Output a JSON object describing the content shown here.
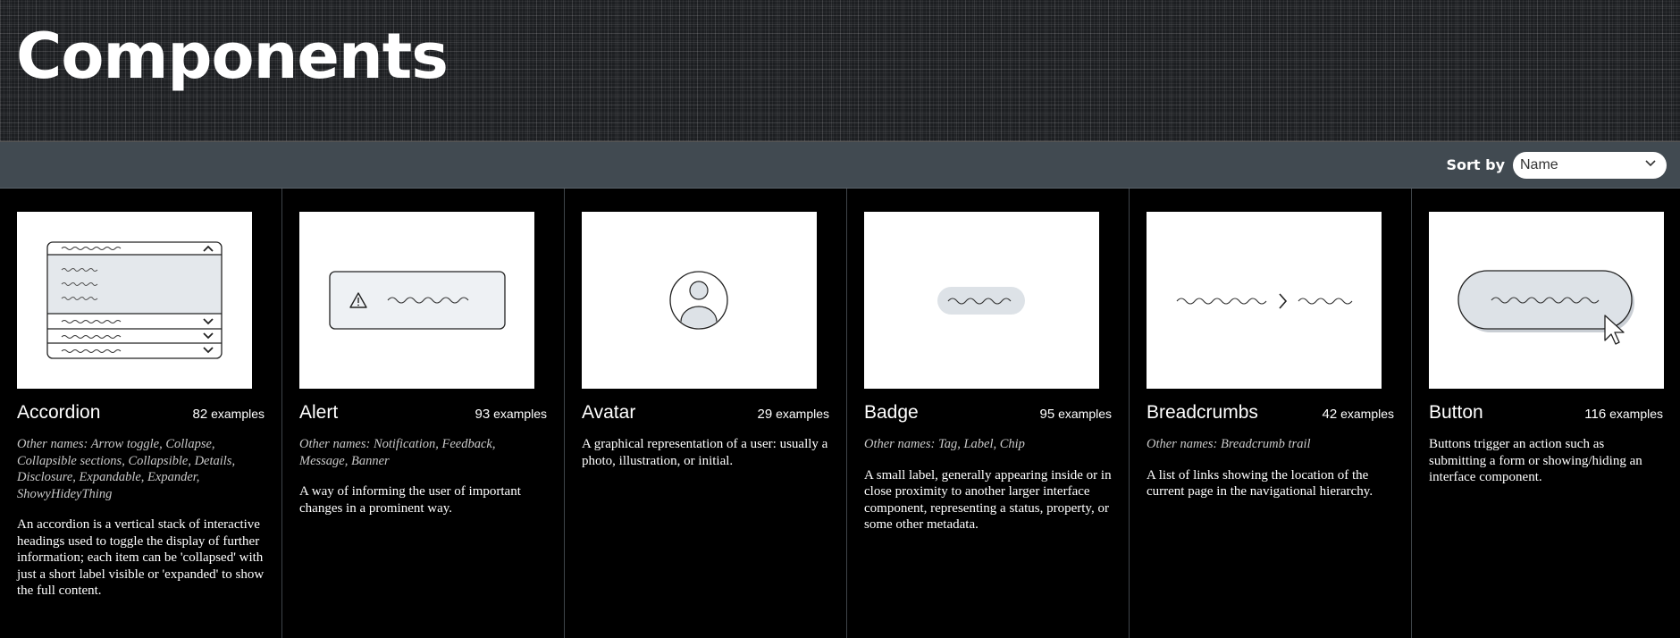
{
  "page": {
    "title": "Components"
  },
  "sort": {
    "label": "Sort by",
    "value": "Name"
  },
  "cards": [
    {
      "name": "Accordion",
      "count": "82",
      "count_suffix": "examples",
      "other_names": "Other names: Arrow toggle, Collapse, Collapsible sections, Collapsible, Details, Disclosure, Expandable, Expander, ShowyHideyThing",
      "description": "An accordion is a vertical stack of interactive headings used to toggle the display of further information; each item can be 'collapsed' with just a short label visible or 'expanded' to show the full content."
    },
    {
      "name": "Alert",
      "count": "93",
      "count_suffix": "examples",
      "other_names": "Other names: Notification, Feedback, Message, Banner",
      "description": "A way of informing the user of important changes in a prominent way."
    },
    {
      "name": "Avatar",
      "count": "29",
      "count_suffix": "examples",
      "other_names": "",
      "description": "A graphical representation of a user: usually a photo, illustration, or initial."
    },
    {
      "name": "Badge",
      "count": "95",
      "count_suffix": "examples",
      "other_names": "Other names: Tag, Label, Chip",
      "description": "A small label, generally appearing inside or in close proximity to another larger interface component, representing a status, property, or some other metadata."
    },
    {
      "name": "Breadcrumbs",
      "count": "42",
      "count_suffix": "examples",
      "other_names": "Other names: Breadcrumb trail",
      "description": "A list of links showing the location of the current page in the navigational hierarchy."
    },
    {
      "name": "Button",
      "count": "116",
      "count_suffix": "examples",
      "other_names": "",
      "description": "Buttons trigger an action such as submitting a form or showing/hiding an interface component."
    }
  ],
  "icons": {
    "sort_chevron": "chevron-down-icon",
    "alert_symbol": "warning-triangle-icon",
    "avatar_symbol": "user-silhouette-icon",
    "breadcrumb_separator": "chevron-right-icon",
    "button_cursor": "mouse-pointer-icon"
  }
}
